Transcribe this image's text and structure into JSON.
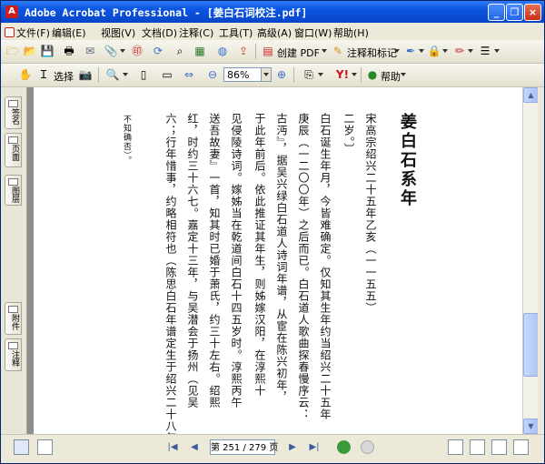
{
  "window": {
    "title": "Adobe Acrobat Professional - [姜白石词校注.pdf]",
    "app_icon": "acrobat-icon",
    "controls": [
      "minimize",
      "restore",
      "close"
    ]
  },
  "menu": {
    "items": [
      "文件(F)",
      "编辑(E)",
      "视图(V)",
      "文档(D)",
      "注释(C)",
      "工具(T)",
      "高级(A)",
      "窗口(W)",
      "帮助(H)"
    ]
  },
  "toolbar1": {
    "create_pdf_label": "创建 PDF",
    "comment_label": "注释和标记"
  },
  "toolbar2": {
    "select_label": "选择",
    "zoom_value": "86%",
    "help_label": "帮助"
  },
  "left_tabs": [
    "签名",
    "页面",
    "图层",
    "附件",
    "注释"
  ],
  "document": {
    "title": "姜白石系年",
    "columns": [
      "宋高宗绍兴二十五年乙亥（一一五五）",
      "二岁。〕",
      "白石诞生年月，今皆难确定。仅知其生年约当绍兴二十五年",
      "庚辰（一二〇〇年）之后而已。白石道人歌曲探春慢序云：",
      "古沔』，据吴兴绿白石道人诗词年谱，从宦在陈兴初年，",
      "于此年前后。依此推证其年生，则姊嫁汉阳，在淳熙十",
      "见侵陵诗词。嫁姊当在乾道间白石十四五岁时。淳熙丙午",
      "送吾故妻』一首，知其时已婚于萧氏，约三十左右。绍熙",
      "红，时约三十六七。嘉定十三年，与吴潜会于扬州（见吴",
      "六；行年惜事，约略相符也（陈思白石年谱定生于绍兴二十八年",
      "不知确否）。"
    ]
  },
  "status": {
    "page_label": "第 251 / 279 页",
    "current_page": 251,
    "total_pages": 279
  },
  "colors": {
    "titlebar": "#0A54E0",
    "chrome": "#ECE9D8",
    "doc_background": "#8D8D8D",
    "page": "#FFFFFF"
  }
}
